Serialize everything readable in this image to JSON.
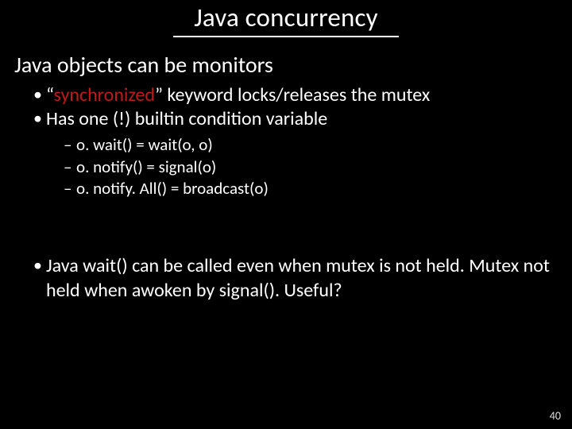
{
  "title": "Java concurrency",
  "subhead": "Java objects can be monitors",
  "bullet1_pre": "“",
  "bullet1_kw": "synchronized",
  "bullet1_post": "” keyword locks/releases the mutex",
  "bullet2": "Has one (!) builtin condition variable",
  "sub": {
    "a": "o. wait() = wait(o, o)",
    "b": "o. notify() = signal(o)",
    "c": "o. notify. All() = broadcast(o)"
  },
  "bullet3": "Java wait() can be called even when mutex is not held. Mutex not held when awoken by signal(). Useful?",
  "page": "40"
}
